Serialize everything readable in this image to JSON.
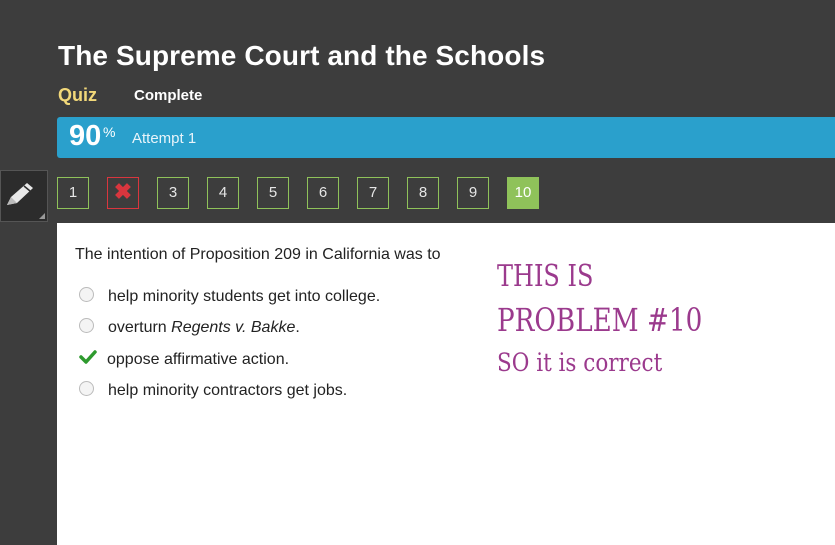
{
  "header": {
    "title": "The Supreme Court and the Schools",
    "quiz_label": "Quiz",
    "status": "Complete"
  },
  "score": {
    "value": "90",
    "percent_sign": "%",
    "attempt": "Attempt 1"
  },
  "question_nav": [
    {
      "label": "1",
      "state": "correct"
    },
    {
      "label": "",
      "state": "incorrect",
      "icon": "x-icon"
    },
    {
      "label": "3",
      "state": "correct"
    },
    {
      "label": "4",
      "state": "correct"
    },
    {
      "label": "5",
      "state": "correct"
    },
    {
      "label": "6",
      "state": "correct"
    },
    {
      "label": "7",
      "state": "correct"
    },
    {
      "label": "8",
      "state": "correct"
    },
    {
      "label": "9",
      "state": "correct"
    },
    {
      "label": "10",
      "state": "current"
    }
  ],
  "question": {
    "text": "The intention of Proposition 209 in California was to",
    "choices": [
      {
        "text": "help minority students get into college.",
        "selected": false
      },
      {
        "text_before": "overturn ",
        "text_italic": "Regents v. Bakke",
        "text_after": ".",
        "selected": false
      },
      {
        "text": "oppose affirmative action.",
        "selected": true
      },
      {
        "text": "help minority contractors get jobs.",
        "selected": false
      }
    ]
  },
  "annotation": {
    "line1": "THIS IS",
    "line2": "PROBLEM #10",
    "line3": "SO it is correct"
  },
  "colors": {
    "background": "#3d3d3d",
    "score_bar": "#2aa0cc",
    "nav_border": "#8fc25a",
    "wrong": "#d9363e",
    "annotation": "#9b3a8d"
  }
}
